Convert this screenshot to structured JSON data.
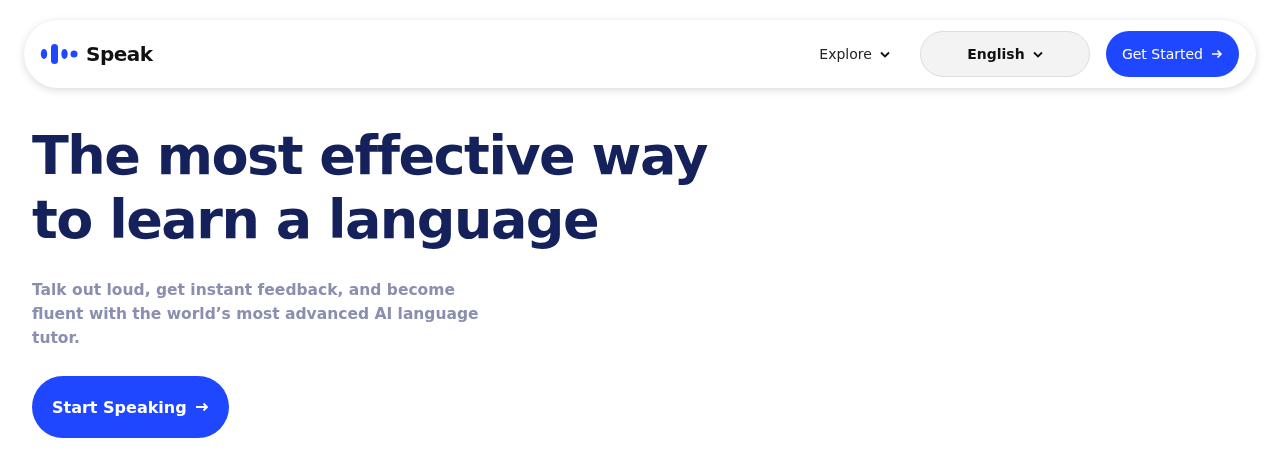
{
  "nav": {
    "brand": "Speak",
    "explore": "Explore",
    "language": "English",
    "cta": "Get Started"
  },
  "hero": {
    "title": "The most effective way to learn a language",
    "subtitle": "Talk out loud, get instant feedback, and become fluent with the world’s most advanced AI language tutor.",
    "cta": "Start Speaking"
  }
}
